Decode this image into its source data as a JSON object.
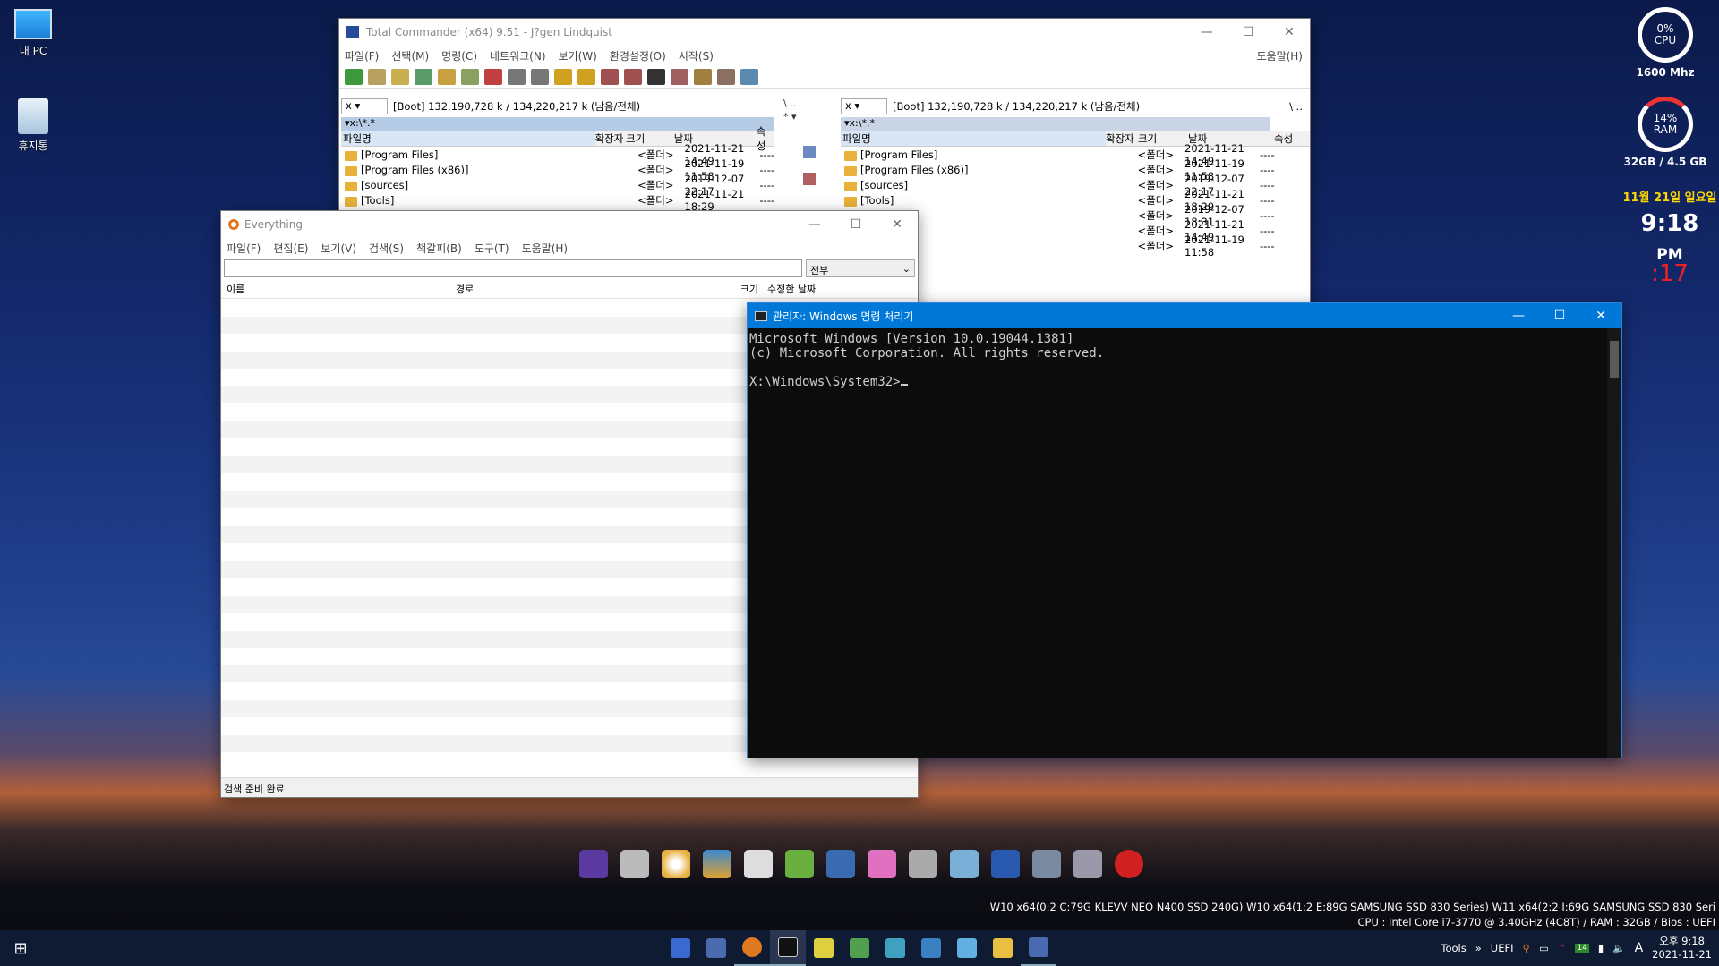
{
  "desktop": {
    "icons": [
      {
        "label": "내 PC"
      },
      {
        "label": "휴지통"
      }
    ]
  },
  "widgets": {
    "cpu_pct": "0%",
    "cpu_label": "CPU",
    "cpu_freq": "1600 Mhz",
    "ram_pct": "14%",
    "ram_label": "RAM",
    "ram_total": "32GB / 4.5 GB",
    "date": "11월 21일 일요일",
    "time": "9:18",
    "ampm": "PM",
    "seconds": ":17"
  },
  "tc": {
    "title": "Total Commander (x64) 9.51 - J?gen Lindquist",
    "menu": [
      "파일(F)",
      "선택(M)",
      "명령(C)",
      "네트워크(N)",
      "보기(W)",
      "환경설정(O)",
      "시작(S)"
    ],
    "help": "도움말(H)",
    "drive": "x",
    "drive_info": "[Boot]  132,190,728 k / 134,220,217 k (남음/전체)",
    "path": "x:\\*.*",
    "cols": {
      "name": "파일명",
      "ext": "확장자",
      "size": "크기",
      "date": "날짜",
      "attr": "속성"
    },
    "left_files": [
      {
        "name": "[Program Files]",
        "size": "<폴더>",
        "date": "2021-11-21 14:49",
        "attr": "----"
      },
      {
        "name": "[Program Files (x86)]",
        "size": "<폴더>",
        "date": "2021-11-19 11:58",
        "attr": "----"
      },
      {
        "name": "[sources]",
        "size": "<폴더>",
        "date": "2019-12-07 22:17",
        "attr": "----"
      },
      {
        "name": "[Tools]",
        "size": "<폴더>",
        "date": "2021-11-21 18:29",
        "attr": "----"
      }
    ],
    "right_files": [
      {
        "name": "[Program Files]",
        "size": "<폴더>",
        "date": "2021-11-21 14:49",
        "attr": "----"
      },
      {
        "name": "[Program Files (x86)]",
        "size": "<폴더>",
        "date": "2021-11-19 11:58",
        "attr": "----"
      },
      {
        "name": "[sources]",
        "size": "<폴더>",
        "date": "2019-12-07 22:17",
        "attr": "----"
      },
      {
        "name": "[Tools]",
        "size": "<폴더>",
        "date": "2021-11-21 18:29",
        "attr": "----"
      },
      {
        "name": "",
        "size": "<폴더>",
        "date": "2019-12-07 18:31",
        "attr": "----"
      },
      {
        "name": "",
        "size": "<폴더>",
        "date": "2021-11-21 14:49",
        "attr": "----"
      },
      {
        "name": "",
        "size": "<폴더>",
        "date": "2021-11-19 11:58",
        "attr": "----"
      }
    ]
  },
  "everything": {
    "title": "Everything",
    "menu": [
      "파일(F)",
      "편집(E)",
      "보기(V)",
      "검색(S)",
      "책갈피(B)",
      "도구(T)",
      "도움말(H)"
    ],
    "filter": "전부",
    "search_placeholder": "",
    "cols": {
      "name": "이름",
      "path": "경로",
      "size": "크기",
      "modified": "수정한 날짜"
    },
    "status": "검색 준비 완료"
  },
  "cmd": {
    "title": "관리자: Windows 명령 처리기",
    "lines": [
      "Microsoft Windows [Version 10.0.19044.1381]",
      "(c) Microsoft Corporation. All rights reserved.",
      "",
      "X:\\Windows\\System32>"
    ]
  },
  "info": {
    "line1": "W10  x64(0:2 C:79G KLEVV NEO N400 SSD 240G) W10  x64(1:2 E:89G SAMSUNG SSD 830 Series) W11  x64(2:2 I:69G SAMSUNG SSD 830 Seri",
    "line2": "CPU : Intel Core i7-3770 @ 3.40GHz (4C8T) / RAM : 32GB / Bios : UEFI"
  },
  "taskbar": {
    "tools": "Tools",
    "uefi": "UEFI",
    "lang": "A",
    "time": "오후 9:18",
    "date": "2021-11-21",
    "badge": "14"
  }
}
